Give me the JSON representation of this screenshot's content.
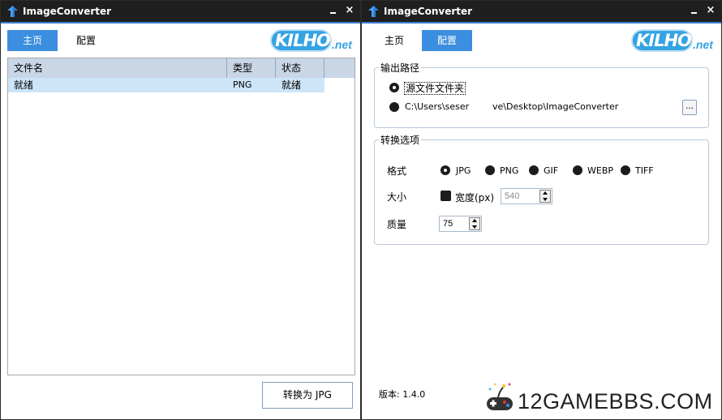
{
  "left_window": {
    "title": "ImageConverter",
    "close_glyph": "×",
    "tabs": [
      {
        "label": "主页",
        "active": true
      },
      {
        "label": "配置",
        "active": false
      }
    ],
    "logo": {
      "text": "KILHO",
      "suffix": ".net"
    },
    "list": {
      "columns": [
        "文件名",
        "类型",
        "状态"
      ],
      "rows": [
        {
          "name": "就绪",
          "type": "PNG",
          "status": "就绪"
        }
      ]
    },
    "convert_button": "转换为 JPG"
  },
  "right_window": {
    "title": "ImageConverter",
    "close_glyph": "×",
    "tabs": [
      {
        "label": "主页",
        "active": false
      },
      {
        "label": "配置",
        "active": true
      }
    ],
    "logo": {
      "text": "KILHO",
      "suffix": ".net"
    },
    "output_path": {
      "group_label": "输出路径",
      "source_folder_option": "源文件文件夹",
      "custom_path_prefix": "C:\\Users\\seser",
      "custom_path_suffix": "ve\\Desktop\\ImageConverter",
      "browse_label": "...",
      "selected": "source_folder"
    },
    "convert_options": {
      "group_label": "转换选项",
      "format_label": "格式",
      "formats": [
        "JPG",
        "PNG",
        "GIF",
        "WEBP",
        "TIFF"
      ],
      "selected_format": "JPG",
      "size_label": "大小",
      "width_checkbox_label": "宽度(px)",
      "width_value": "540",
      "width_enabled": false,
      "quality_label": "质量",
      "quality_value": "75"
    },
    "version": "版本: 1.4.0"
  },
  "watermark": {
    "text": "12GAMEBBS.COM"
  },
  "colors": {
    "titlebar": "#1f1f1f",
    "accent": "#3a7fd0",
    "tab_active": "#3c8ee0",
    "list_header": "#c9d6e6",
    "row_selected": "#cde5f8",
    "logo": "#35a3e3"
  }
}
